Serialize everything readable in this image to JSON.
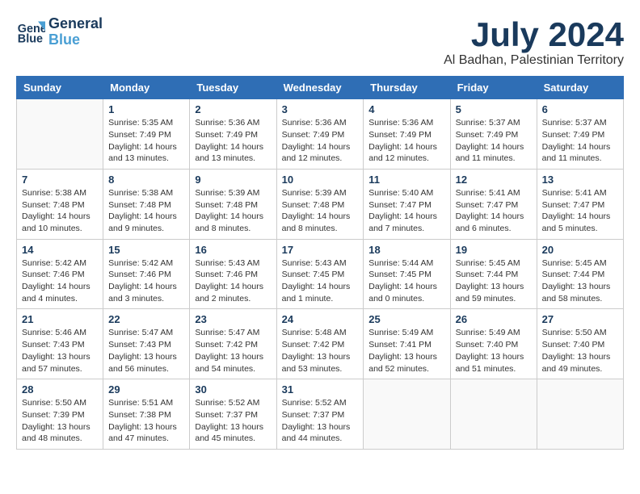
{
  "header": {
    "logo_line1": "General",
    "logo_line2": "Blue",
    "title": "July 2024",
    "subtitle": "Al Badhan, Palestinian Territory"
  },
  "calendar": {
    "days_of_week": [
      "Sunday",
      "Monday",
      "Tuesday",
      "Wednesday",
      "Thursday",
      "Friday",
      "Saturday"
    ],
    "weeks": [
      [
        {
          "day": "",
          "info": ""
        },
        {
          "day": "1",
          "info": "Sunrise: 5:35 AM\nSunset: 7:49 PM\nDaylight: 14 hours\nand 13 minutes."
        },
        {
          "day": "2",
          "info": "Sunrise: 5:36 AM\nSunset: 7:49 PM\nDaylight: 14 hours\nand 13 minutes."
        },
        {
          "day": "3",
          "info": "Sunrise: 5:36 AM\nSunset: 7:49 PM\nDaylight: 14 hours\nand 12 minutes."
        },
        {
          "day": "4",
          "info": "Sunrise: 5:36 AM\nSunset: 7:49 PM\nDaylight: 14 hours\nand 12 minutes."
        },
        {
          "day": "5",
          "info": "Sunrise: 5:37 AM\nSunset: 7:49 PM\nDaylight: 14 hours\nand 11 minutes."
        },
        {
          "day": "6",
          "info": "Sunrise: 5:37 AM\nSunset: 7:49 PM\nDaylight: 14 hours\nand 11 minutes."
        }
      ],
      [
        {
          "day": "7",
          "info": "Sunrise: 5:38 AM\nSunset: 7:48 PM\nDaylight: 14 hours\nand 10 minutes."
        },
        {
          "day": "8",
          "info": "Sunrise: 5:38 AM\nSunset: 7:48 PM\nDaylight: 14 hours\nand 9 minutes."
        },
        {
          "day": "9",
          "info": "Sunrise: 5:39 AM\nSunset: 7:48 PM\nDaylight: 14 hours\nand 8 minutes."
        },
        {
          "day": "10",
          "info": "Sunrise: 5:39 AM\nSunset: 7:48 PM\nDaylight: 14 hours\nand 8 minutes."
        },
        {
          "day": "11",
          "info": "Sunrise: 5:40 AM\nSunset: 7:47 PM\nDaylight: 14 hours\nand 7 minutes."
        },
        {
          "day": "12",
          "info": "Sunrise: 5:41 AM\nSunset: 7:47 PM\nDaylight: 14 hours\nand 6 minutes."
        },
        {
          "day": "13",
          "info": "Sunrise: 5:41 AM\nSunset: 7:47 PM\nDaylight: 14 hours\nand 5 minutes."
        }
      ],
      [
        {
          "day": "14",
          "info": "Sunrise: 5:42 AM\nSunset: 7:46 PM\nDaylight: 14 hours\nand 4 minutes."
        },
        {
          "day": "15",
          "info": "Sunrise: 5:42 AM\nSunset: 7:46 PM\nDaylight: 14 hours\nand 3 minutes."
        },
        {
          "day": "16",
          "info": "Sunrise: 5:43 AM\nSunset: 7:46 PM\nDaylight: 14 hours\nand 2 minutes."
        },
        {
          "day": "17",
          "info": "Sunrise: 5:43 AM\nSunset: 7:45 PM\nDaylight: 14 hours\nand 1 minute."
        },
        {
          "day": "18",
          "info": "Sunrise: 5:44 AM\nSunset: 7:45 PM\nDaylight: 14 hours\nand 0 minutes."
        },
        {
          "day": "19",
          "info": "Sunrise: 5:45 AM\nSunset: 7:44 PM\nDaylight: 13 hours\nand 59 minutes."
        },
        {
          "day": "20",
          "info": "Sunrise: 5:45 AM\nSunset: 7:44 PM\nDaylight: 13 hours\nand 58 minutes."
        }
      ],
      [
        {
          "day": "21",
          "info": "Sunrise: 5:46 AM\nSunset: 7:43 PM\nDaylight: 13 hours\nand 57 minutes."
        },
        {
          "day": "22",
          "info": "Sunrise: 5:47 AM\nSunset: 7:43 PM\nDaylight: 13 hours\nand 56 minutes."
        },
        {
          "day": "23",
          "info": "Sunrise: 5:47 AM\nSunset: 7:42 PM\nDaylight: 13 hours\nand 54 minutes."
        },
        {
          "day": "24",
          "info": "Sunrise: 5:48 AM\nSunset: 7:42 PM\nDaylight: 13 hours\nand 53 minutes."
        },
        {
          "day": "25",
          "info": "Sunrise: 5:49 AM\nSunset: 7:41 PM\nDaylight: 13 hours\nand 52 minutes."
        },
        {
          "day": "26",
          "info": "Sunrise: 5:49 AM\nSunset: 7:40 PM\nDaylight: 13 hours\nand 51 minutes."
        },
        {
          "day": "27",
          "info": "Sunrise: 5:50 AM\nSunset: 7:40 PM\nDaylight: 13 hours\nand 49 minutes."
        }
      ],
      [
        {
          "day": "28",
          "info": "Sunrise: 5:50 AM\nSunset: 7:39 PM\nDaylight: 13 hours\nand 48 minutes."
        },
        {
          "day": "29",
          "info": "Sunrise: 5:51 AM\nSunset: 7:38 PM\nDaylight: 13 hours\nand 47 minutes."
        },
        {
          "day": "30",
          "info": "Sunrise: 5:52 AM\nSunset: 7:37 PM\nDaylight: 13 hours\nand 45 minutes."
        },
        {
          "day": "31",
          "info": "Sunrise: 5:52 AM\nSunset: 7:37 PM\nDaylight: 13 hours\nand 44 minutes."
        },
        {
          "day": "",
          "info": ""
        },
        {
          "day": "",
          "info": ""
        },
        {
          "day": "",
          "info": ""
        }
      ]
    ]
  }
}
